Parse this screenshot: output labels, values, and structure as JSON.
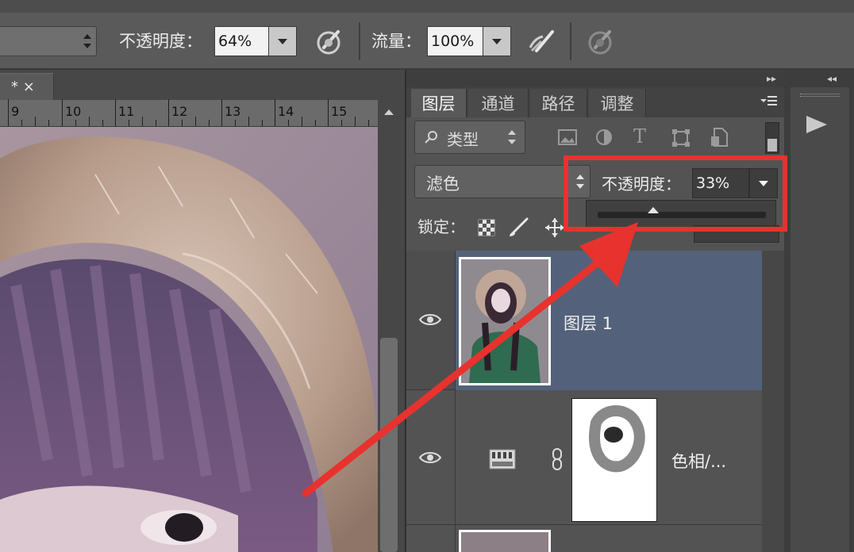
{
  "options_bar": {
    "opacity_label": "不透明度：",
    "opacity_value": "64%",
    "flow_label": "流量：",
    "flow_value": "100%"
  },
  "document_tab": {
    "label": "* ×"
  },
  "ruler": {
    "numbers": [
      "9",
      "10",
      "11",
      "12",
      "13",
      "14",
      "15"
    ]
  },
  "layers_panel": {
    "tabs": [
      "图层",
      "通道",
      "路径",
      "调整"
    ],
    "filter_label": "类型",
    "blend_mode": "滤色",
    "opacity_label": "不透明度：",
    "opacity_value": "33%",
    "opacity_slider_fraction": 0.33,
    "lock_label": "锁定：",
    "layers": [
      {
        "name": "图层 1",
        "selected": true
      },
      {
        "name": "色相/...",
        "selected": false
      }
    ]
  },
  "colors": {
    "highlight": "#e8322e",
    "selected_layer": "#53627a",
    "panel_bg": "#535353"
  },
  "icons": [
    "search-icon",
    "image-filter-icon",
    "adjustment-filter-icon",
    "text-filter-icon",
    "shape-filter-icon",
    "smart-object-filter-icon",
    "lock-pixels-icon",
    "lock-brush-icon",
    "lock-position-icon",
    "eye-icon",
    "link-icon",
    "panel-menu-icon",
    "play-icon"
  ]
}
